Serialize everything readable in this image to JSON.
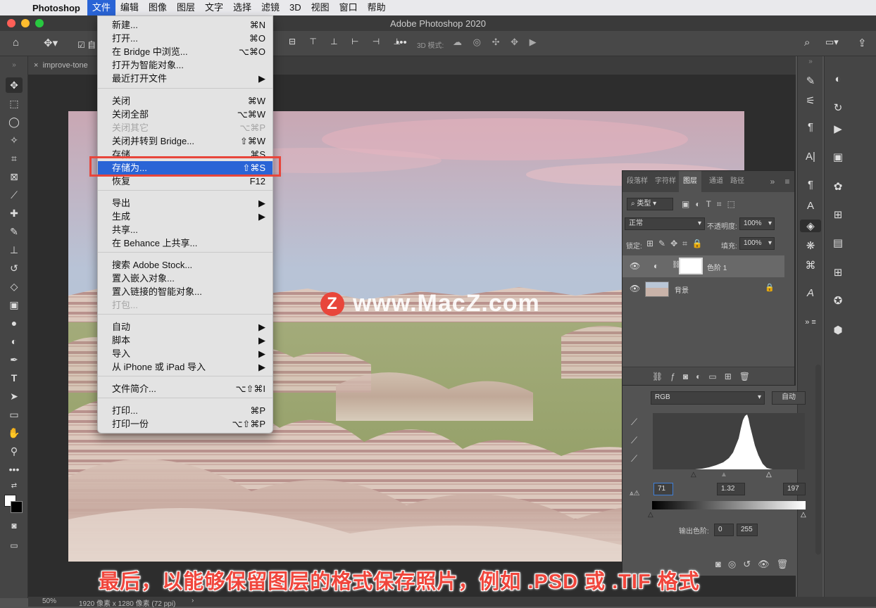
{
  "menubar": {
    "app_name": "Photoshop",
    "items": [
      "文件",
      "编辑",
      "图像",
      "图层",
      "文字",
      "选择",
      "滤镜",
      "3D",
      "视图",
      "窗口",
      "帮助"
    ]
  },
  "window": {
    "title": "Adobe Photoshop 2020"
  },
  "options_bar": {
    "auto_select_label": "自",
    "mode_3d_label": "3D 模式:"
  },
  "document_tab": {
    "name": "improve-tone"
  },
  "file_menu": {
    "items": [
      {
        "label": "新建...",
        "shortcut": "⌘N"
      },
      {
        "label": "打开...",
        "shortcut": "⌘O"
      },
      {
        "label": "在 Bridge 中浏览...",
        "shortcut": "⌥⌘O"
      },
      {
        "label": "打开为智能对象...",
        "shortcut": ""
      },
      {
        "label": "最近打开文件",
        "shortcut": "▶"
      },
      {
        "label": "关闭",
        "shortcut": "⌘W"
      },
      {
        "label": "关闭全部",
        "shortcut": "⌥⌘W"
      },
      {
        "label": "关闭其它",
        "shortcut": "⌥⌘P"
      },
      {
        "label": "关闭并转到 Bridge...",
        "shortcut": "⇧⌘W"
      },
      {
        "label": "存储",
        "shortcut": "⌘S"
      },
      {
        "label": "存储为...",
        "shortcut": "⇧⌘S"
      },
      {
        "label": "恢复",
        "shortcut": "F12"
      },
      {
        "label": "导出",
        "shortcut": "▶"
      },
      {
        "label": "生成",
        "shortcut": "▶"
      },
      {
        "label": "共享...",
        "shortcut": ""
      },
      {
        "label": "在 Behance 上共享...",
        "shortcut": ""
      },
      {
        "label": "搜索 Adobe Stock...",
        "shortcut": ""
      },
      {
        "label": "置入嵌入对象...",
        "shortcut": ""
      },
      {
        "label": "置入链接的智能对象...",
        "shortcut": ""
      },
      {
        "label": "打包...",
        "shortcut": ""
      },
      {
        "label": "自动",
        "shortcut": "▶"
      },
      {
        "label": "脚本",
        "shortcut": "▶"
      },
      {
        "label": "导入",
        "shortcut": "▶"
      },
      {
        "label": "从 iPhone 或 iPad 导入",
        "shortcut": "▶"
      },
      {
        "label": "文件简介...",
        "shortcut": "⌥⇧⌘I"
      },
      {
        "label": "打印...",
        "shortcut": "⌘P"
      },
      {
        "label": "打印一份",
        "shortcut": "⌥⇧⌘P"
      }
    ]
  },
  "layers_panel": {
    "tabs": [
      "段落样",
      "字符样",
      "图层",
      "通道",
      "路径"
    ],
    "filter_label": "类型",
    "blend_mode": "正常",
    "opacity_label": "不透明度:",
    "opacity_value": "100%",
    "lock_label": "锁定:",
    "fill_label": "填充:",
    "fill_value": "100%",
    "layers": [
      {
        "name": "色阶 1"
      },
      {
        "name": "背景"
      }
    ]
  },
  "properties_panel": {
    "channel": "RGB",
    "auto_button": "自动",
    "input_black": "71",
    "input_gamma": "1.32",
    "input_white": "197",
    "output_label": "输出色阶:",
    "output_black": "0",
    "output_white": "255"
  },
  "status_bar": {
    "zoom": "50%",
    "doc_info": "1920 像素 x 1280 像素 (72 ppi)"
  },
  "overlay": {
    "watermark": "www.MacZ.com",
    "watermark_logo": "Z",
    "subtitle": "最后，以能够保留图层的格式保存照片，例如 .PSD 或 .TIF 格式"
  },
  "colors": {
    "highlight": "#2a64d6",
    "annotation_red": "#e8463b"
  }
}
